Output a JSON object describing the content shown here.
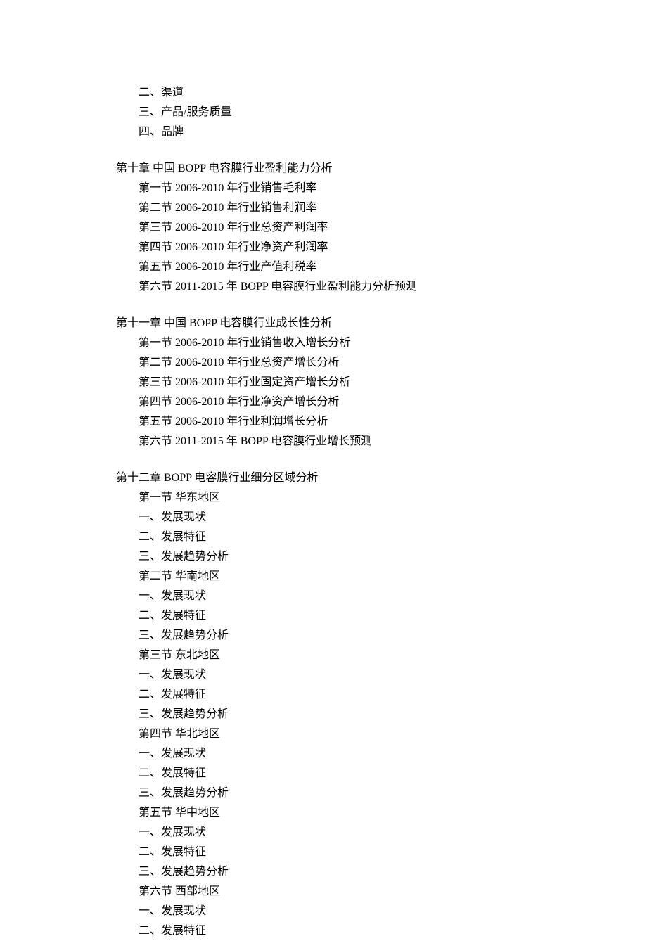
{
  "prelude": {
    "items": [
      "二、渠道",
      "三、产品/服务质量",
      "四、品牌"
    ]
  },
  "chapters": [
    {
      "title": "第十章 中国 BOPP 电容膜行业盈利能力分析",
      "sections": [
        {
          "label": "第一节 2006-2010 年行业销售毛利率"
        },
        {
          "label": "第二节 2006-2010 年行业销售利润率"
        },
        {
          "label": "第三节 2006-2010 年行业总资产利润率"
        },
        {
          "label": "第四节 2006-2010 年行业净资产利润率"
        },
        {
          "label": "第五节 2006-2010 年行业产值利税率"
        },
        {
          "label": "第六节 2011-2015 年 BOPP 电容膜行业盈利能力分析预测"
        }
      ]
    },
    {
      "title": "第十一章 中国 BOPP 电容膜行业成长性分析",
      "sections": [
        {
          "label": "第一节 2006-2010 年行业销售收入增长分析"
        },
        {
          "label": "第二节 2006-2010 年行业总资产增长分析"
        },
        {
          "label": "第三节 2006-2010 年行业固定资产增长分析"
        },
        {
          "label": "第四节 2006-2010 年行业净资产增长分析"
        },
        {
          "label": "第五节 2006-2010 年行业利润增长分析"
        },
        {
          "label": "第六节 2011-2015 年 BOPP 电容膜行业增长预测"
        }
      ]
    },
    {
      "title": "第十二章 BOPP 电容膜行业细分区域分析",
      "sections": [
        {
          "label": "第一节 华东地区",
          "items": [
            "一、发展现状",
            "二、发展特征",
            "三、发展趋势分析"
          ]
        },
        {
          "label": "第二节 华南地区",
          "items": [
            "一、发展现状",
            "二、发展特征",
            "三、发展趋势分析"
          ]
        },
        {
          "label": "第三节 东北地区",
          "items": [
            "一、发展现状",
            "二、发展特征",
            "三、发展趋势分析"
          ]
        },
        {
          "label": "第四节 华北地区",
          "items": [
            "一、发展现状",
            "二、发展特征",
            "三、发展趋势分析"
          ]
        },
        {
          "label": "第五节 华中地区",
          "items": [
            "一、发展现状",
            "二、发展特征",
            "三、发展趋势分析"
          ]
        },
        {
          "label": "第六节 西部地区",
          "items": [
            "一、发展现状",
            "二、发展特征"
          ]
        }
      ]
    }
  ]
}
